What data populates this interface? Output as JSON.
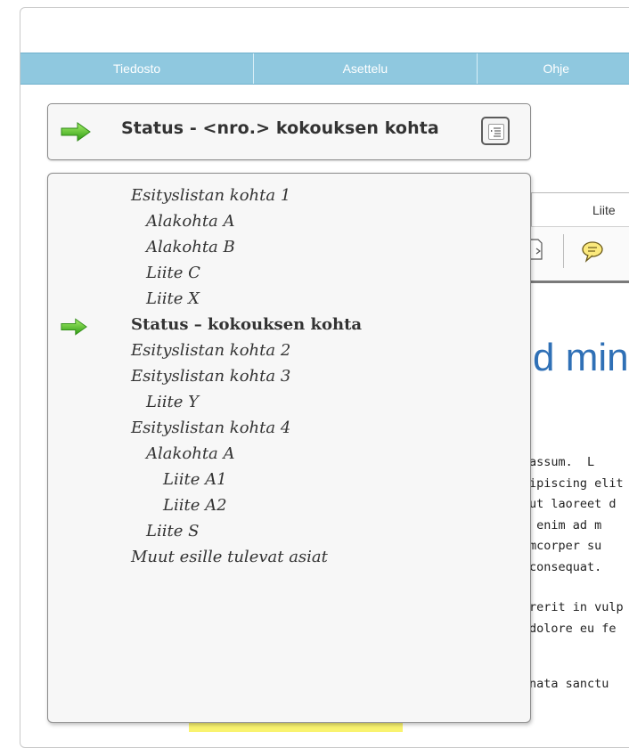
{
  "menu": {
    "items": [
      {
        "label": "Tiedosto",
        "width": 262
      },
      {
        "label": "Asettelu",
        "width": 250
      },
      {
        "label": "Ohje",
        "width": 178
      }
    ]
  },
  "status": {
    "title": "Status - <nro.> kokouksen kohta"
  },
  "agenda": {
    "items": [
      {
        "label": "Esityslistan kohta 1",
        "level": 0
      },
      {
        "label": "Alakohta A",
        "level": 1
      },
      {
        "label": "Alakohta B",
        "level": 1
      },
      {
        "label": "Liite C",
        "level": 1
      },
      {
        "label": "Liite X",
        "level": 1
      },
      {
        "label": "Status – kokouksen kohta",
        "level": 0,
        "current": true
      },
      {
        "label": "Esityslistan kohta 2",
        "level": 0
      },
      {
        "label": "Esityslistan kohta 3",
        "level": 0
      },
      {
        "label": "Liite Y",
        "level": 1
      },
      {
        "label": "Esityslistan kohta 4",
        "level": 0
      },
      {
        "label": "Alakohta A",
        "level": 1
      },
      {
        "label": "Liite A1",
        "level": 2
      },
      {
        "label": "Liite A2",
        "level": 2
      },
      {
        "label": "Liite S",
        "level": 1
      },
      {
        "label": "Muut esille tulevat asiat",
        "level": 0
      }
    ]
  },
  "document": {
    "tab_label": "Liite",
    "title_partial": "d min",
    "text_lines": [
      "assum.  L",
      "ipiscing elit",
      "ut laoreet d",
      " enim ad m",
      "mcorper su",
      "consequat."
    ],
    "text_lines_2": [
      "rerit in vulp",
      "dolore eu fe"
    ],
    "text_line_3": "nata sanctu"
  },
  "colors": {
    "menubar": "#8fc8df",
    "arrow_green": "#5bc62d",
    "doc_title_blue": "#2f70b6"
  }
}
